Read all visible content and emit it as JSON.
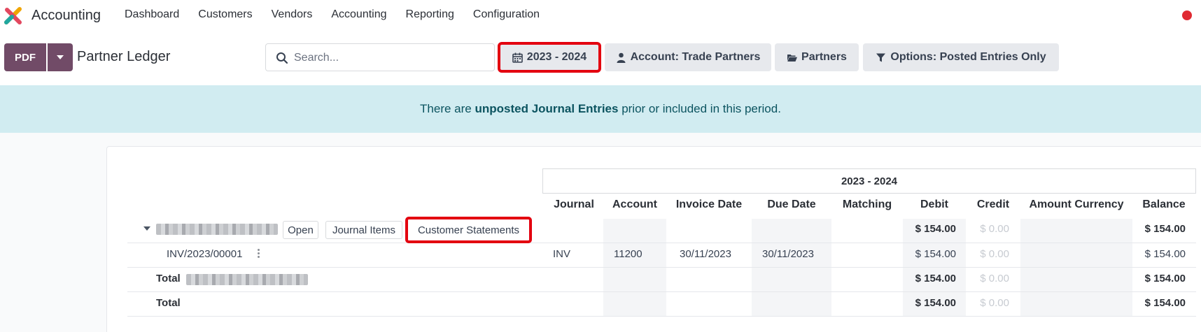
{
  "app": {
    "name": "Accounting",
    "logo_icon": "odoo-accounting-logo-icon"
  },
  "menu": [
    "Dashboard",
    "Customers",
    "Vendors",
    "Accounting",
    "Reporting",
    "Configuration"
  ],
  "toolbar": {
    "pdf_label": "PDF",
    "page_title": "Partner Ledger"
  },
  "search": {
    "placeholder": "Search..."
  },
  "filters": {
    "period": "2023 - 2024",
    "account": "Account: Trade Partners",
    "partners": "Partners",
    "options": "Options: Posted Entries Only"
  },
  "alert": {
    "prefix": "There are ",
    "link": "unposted Journal Entries",
    "suffix": " prior or included in this period."
  },
  "report": {
    "period_header": "2023 - 2024",
    "columns": [
      "Journal",
      "Account",
      "Invoice Date",
      "Due Date",
      "Matching",
      "Debit",
      "Credit",
      "Amount Currency",
      "Balance"
    ],
    "partner_row": {
      "buttons": [
        "Open",
        "Journal Items",
        "Customer Statements"
      ],
      "debit": "$ 154.00",
      "credit": "$ 0.00",
      "balance": "$ 154.00"
    },
    "line": {
      "name": "INV/2023/00001",
      "journal": "INV",
      "account": "11200",
      "invoice_date": "30/11/2023",
      "due_date": "30/11/2023",
      "debit": "$ 154.00",
      "credit": "$ 0.00",
      "balance": "$ 154.00"
    },
    "partner_total": {
      "label": "Total",
      "debit": "$ 154.00",
      "credit": "$ 0.00",
      "balance": "$ 154.00"
    },
    "grand_total": {
      "label": "Total",
      "debit": "$ 154.00",
      "credit": "$ 0.00",
      "balance": "$ 154.00"
    }
  },
  "colors": {
    "primary": "#714b67",
    "alert_bg": "#d1ecf1",
    "alert_text": "#0c5460",
    "highlight": "#e3000f",
    "status_dot": "#e02a32"
  }
}
